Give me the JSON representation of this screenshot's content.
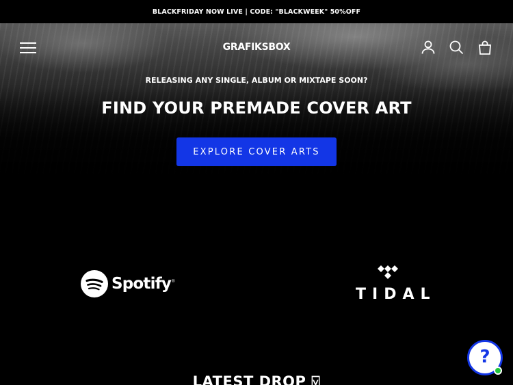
{
  "announcement": {
    "text": "BLACKFRIDAY NOW LIVE | CODE: \"BLACKWEEK\" 50%OFF"
  },
  "header": {
    "menu_icon": "hamburger-menu-icon",
    "brand": "GRAFIKSBOX",
    "icons": [
      "account-icon",
      "search-icon",
      "cart-icon"
    ]
  },
  "hero": {
    "kicker": "RELEASING ANY SINGLE, ALBUM OR MIXTAPE SOON?",
    "title": "FIND YOUR PREMADE COVER ART",
    "cta_label": "EXPLORE COVER ARTS"
  },
  "logos": {
    "spotify": {
      "icon": "spotify-logo-icon",
      "label": "Spotify",
      "trademark": "®"
    },
    "tidal": {
      "icon": "tidal-logo-icon",
      "label": "TIDAL"
    }
  },
  "latest": {
    "title": "LATEST DROP ⍌"
  },
  "help": {
    "icon": "question-mark-icon",
    "label": "?",
    "status": "online"
  },
  "colors": {
    "accent": "#1336e6",
    "background": "#000000",
    "text": "#ffffff",
    "online": "#20c43b"
  }
}
